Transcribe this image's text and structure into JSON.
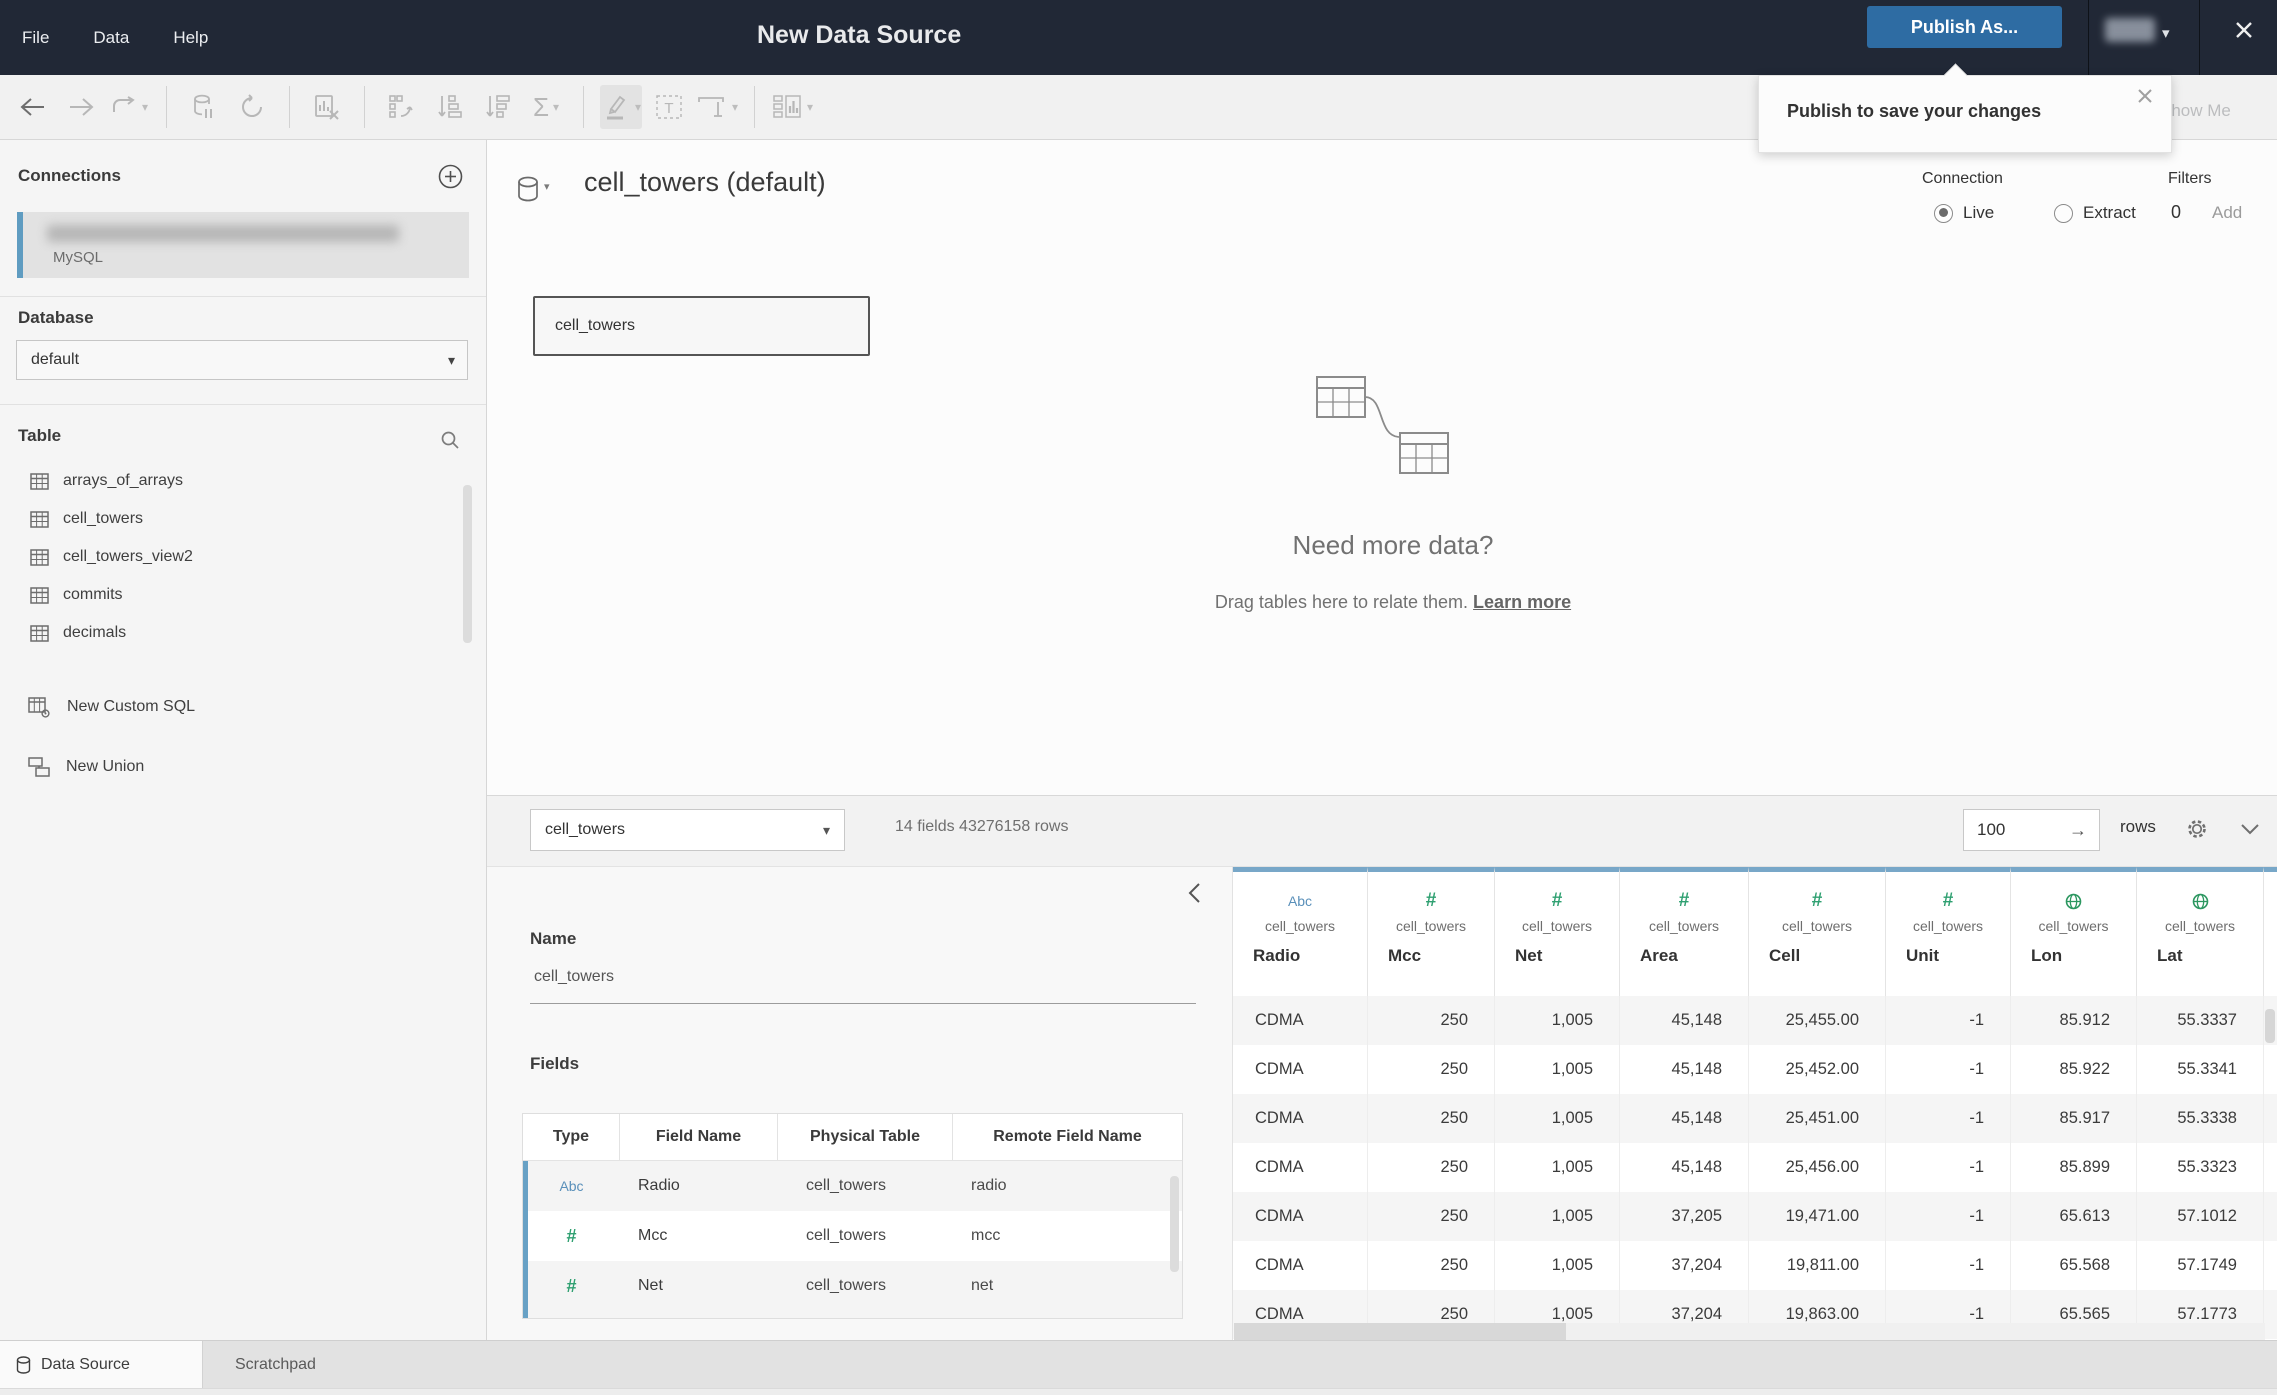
{
  "titlebar": {
    "menus": [
      "File",
      "Data",
      "Help"
    ],
    "title": "New Data Source",
    "publish_button": "Publish As..."
  },
  "tooltip": {
    "text": "Publish to save your changes"
  },
  "toolbar": {
    "show_me": "Show Me",
    "sigma": "Σ",
    "text_tool": "T"
  },
  "sidebar": {
    "connections_title": "Connections",
    "connection": {
      "type": "MySQL"
    },
    "database_label": "Database",
    "database_value": "default",
    "table_label": "Table",
    "tables": [
      "arrays_of_arrays",
      "cell_towers",
      "cell_towers_view2",
      "commits",
      "decimals"
    ],
    "new_custom_sql": "New Custom SQL",
    "new_union": "New Union"
  },
  "canvas": {
    "datasource_title": "cell_towers (default)",
    "connection_label": "Connection",
    "live_label": "Live",
    "extract_label": "Extract",
    "filters_label": "Filters",
    "filters_count": "0",
    "filters_add": "Add",
    "node_label": "cell_towers",
    "empty_title": "Need more data?",
    "empty_subtitle": "Drag tables here to relate them.",
    "empty_link": "Learn more"
  },
  "bottom_toolbar": {
    "table_select": "cell_towers",
    "summary": "14 fields 43276158 rows",
    "rows_value": "100",
    "rows_label": "rows",
    "go_arrow": "→"
  },
  "metadata": {
    "name_label": "Name",
    "name_value": "cell_towers",
    "fields_label": "Fields",
    "columns": [
      "Type",
      "Field Name",
      "Physical Table",
      "Remote Field Name"
    ],
    "rows": [
      {
        "type": "Abc",
        "field": "Radio",
        "table": "cell_towers",
        "remote": "radio"
      },
      {
        "type": "#",
        "field": "Mcc",
        "table": "cell_towers",
        "remote": "mcc"
      },
      {
        "type": "#",
        "field": "Net",
        "table": "cell_towers",
        "remote": "net"
      }
    ]
  },
  "grid": {
    "columns": [
      {
        "icon": "Abc",
        "table": "cell_towers",
        "name": "Radio"
      },
      {
        "icon": "#",
        "table": "cell_towers",
        "name": "Mcc"
      },
      {
        "icon": "#",
        "table": "cell_towers",
        "name": "Net"
      },
      {
        "icon": "#",
        "table": "cell_towers",
        "name": "Area"
      },
      {
        "icon": "#",
        "table": "cell_towers",
        "name": "Cell"
      },
      {
        "icon": "#",
        "table": "cell_towers",
        "name": "Unit"
      },
      {
        "icon": "globe",
        "table": "cell_towers",
        "name": "Lon"
      },
      {
        "icon": "globe",
        "table": "cell_towers",
        "name": "Lat"
      }
    ],
    "rows": [
      [
        "CDMA",
        "250",
        "1,005",
        "45,148",
        "25,455.00",
        "-1",
        "85.912",
        "55.3337"
      ],
      [
        "CDMA",
        "250",
        "1,005",
        "45,148",
        "25,452.00",
        "-1",
        "85.922",
        "55.3341"
      ],
      [
        "CDMA",
        "250",
        "1,005",
        "45,148",
        "25,451.00",
        "-1",
        "85.917",
        "55.3338"
      ],
      [
        "CDMA",
        "250",
        "1,005",
        "45,148",
        "25,456.00",
        "-1",
        "85.899",
        "55.3323"
      ],
      [
        "CDMA",
        "250",
        "1,005",
        "37,205",
        "19,471.00",
        "-1",
        "65.613",
        "57.1012"
      ],
      [
        "CDMA",
        "250",
        "1,005",
        "37,204",
        "19,811.00",
        "-1",
        "65.568",
        "57.1749"
      ],
      [
        "CDMA",
        "250",
        "1,005",
        "37,204",
        "19,863.00",
        "-1",
        "65.565",
        "57.1773"
      ]
    ]
  },
  "statusbar": {
    "tabs": [
      "Data Source",
      "Scratchpad"
    ]
  },
  "colors": {
    "titlebar_bg": "#212836",
    "publish_blue": "#2e6ca3",
    "grid_header_blue": "#78a7c8",
    "field_accent_blue": "#68a1c5",
    "abc_blue": "#5a90ba",
    "measure_green": "#2fa071"
  }
}
